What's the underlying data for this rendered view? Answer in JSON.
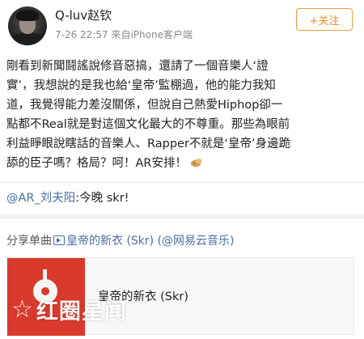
{
  "header": {
    "username": "Q-luv赵钦",
    "timestamp": "7-26 22:57",
    "source": "来自iPhone客户端",
    "follow_label": "+关注"
  },
  "post": {
    "lines": [
      "剛看到新聞鬪謠說修音惡搞，還請了一個音樂人‘證",
      "實’，我想說的是我也給‘皇帝’監棚過，他的能力我知",
      "道，我覺得能力差沒關係，但說自己熱愛Hiphop卻一",
      "點都不Real就是對這個文化最大的不尊重。那些為眼前",
      "利益睜眼說瞎話的音樂人、Rapper不就是‘皇帝’身邊跪",
      "舔的臣子嗎？格局？呵！AR安排！"
    ],
    "emoji": "wheat-emoji"
  },
  "mention": {
    "handle": "@AR_刘夫阳",
    "text": ":今晚 skr!"
  },
  "share": {
    "prefix": "分享单曲",
    "song_link": "皇帝的新衣 (Skr)",
    "source_link": "(@网易云音乐)"
  },
  "card": {
    "title": "皇帝的新衣 (Skr)"
  },
  "watermark": {
    "text": "红圈星闻"
  },
  "colors": {
    "accent": "#f08a24",
    "link": "#4a6ea6",
    "cover": "#d93a2b"
  }
}
